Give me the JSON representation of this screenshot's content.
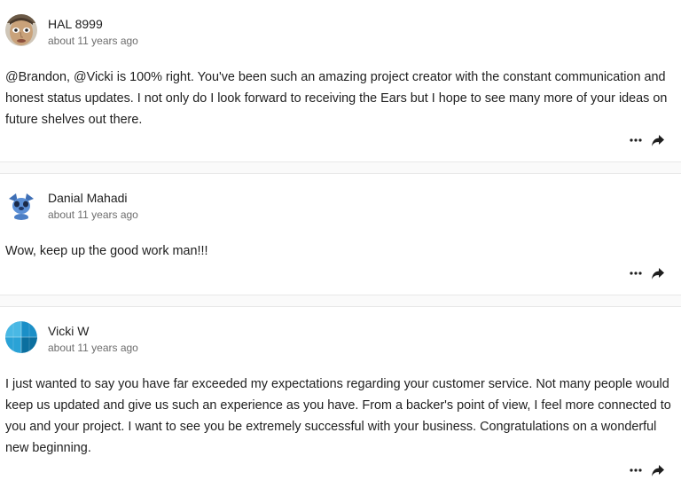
{
  "comments": [
    {
      "author": "HAL 8999",
      "time": "about 11 years ago",
      "avatar": "face-photo-avatar",
      "body": "@Brandon, @Vicki is 100% right. You've been such an amazing project creator with the constant communication and honest status updates. I not only do I look forward to receiving the Ears but I hope to see many more of your ideas on future shelves out there."
    },
    {
      "author": "Danial Mahadi",
      "time": "about 11 years ago",
      "avatar": "stitch-character-avatar",
      "body": "Wow, keep up the good work man!!!"
    },
    {
      "author": "Vicki W",
      "time": "about 11 years ago",
      "avatar": "blue-globe-avatar",
      "body": "I just wanted to say you have far exceeded my expectations regarding your customer service. Not many people would keep us updated and give us such an experience as you have. From a backer's point of view, I feel more connected to you and your project. I want to see you be extremely successful with your business. Congratulations on a wonderful new beginning."
    }
  ],
  "icons": {
    "more": "more-horizontal-icon",
    "share": "share-arrow-icon"
  },
  "colors": {
    "text": "#1e1e1e",
    "muted": "#6e6e6e",
    "separator": "#fafafa"
  }
}
